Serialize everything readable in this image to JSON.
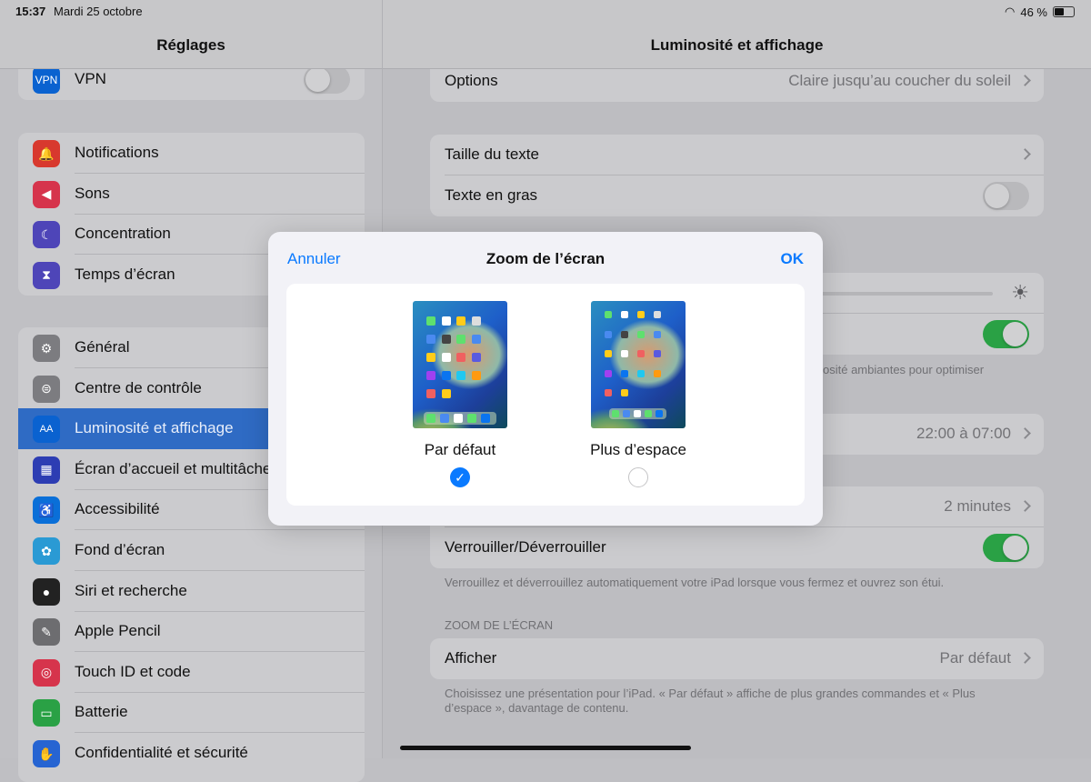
{
  "status": {
    "time": "15:37",
    "date": "Mardi 25 octobre",
    "battery": "46 %"
  },
  "sidebar": {
    "title": "Réglages",
    "vpn": {
      "label": "VPN",
      "icon": "VPN",
      "on": false
    },
    "group1": [
      {
        "label": "Notifications",
        "icon": "bell-icon",
        "color": "#d8392e"
      },
      {
        "label": "Sons",
        "icon": "speaker-icon",
        "color": "#d6344c"
      },
      {
        "label": "Concentration",
        "icon": "moon-icon",
        "color": "#4e45b8"
      },
      {
        "label": "Temps d’écran",
        "icon": "hourglass-icon",
        "color": "#4e45b8"
      }
    ],
    "group2": [
      {
        "label": "Général",
        "icon": "gear-icon",
        "color": "#7c7c80"
      },
      {
        "label": "Centre de contrôle",
        "icon": "switches-icon",
        "color": "#7c7c80"
      },
      {
        "label": "Luminosité et affichage",
        "icon": "AA",
        "color": "#0a62d0",
        "selected": true
      },
      {
        "label": "Écran d’accueil et multitâche",
        "icon": "grid-icon",
        "color": "#2d3db3"
      },
      {
        "label": "Accessibilité",
        "icon": "accessibility-icon",
        "color": "#0a6fd8"
      },
      {
        "label": "Fond d’écran",
        "icon": "flower-icon",
        "color": "#2a9ad4"
      },
      {
        "label": "Siri et recherche",
        "icon": "siri-icon",
        "color": "#222"
      },
      {
        "label": "Apple Pencil",
        "icon": "pencil-icon",
        "color": "#6d6d70"
      },
      {
        "label": "Touch ID et code",
        "icon": "fingerprint-icon",
        "color": "#d6344c"
      },
      {
        "label": "Batterie",
        "icon": "battery-icon",
        "color": "#2aa145"
      },
      {
        "label": "Confidentialité et sécurité",
        "icon": "hand-icon",
        "color": "#2664d2"
      }
    ]
  },
  "main": {
    "title": "Luminosité et affichage",
    "options": {
      "label": "Options",
      "value": "Claire jusqu’au coucher du soleil"
    },
    "text_size": "Taille du texte",
    "bold_text": "Texte en gras",
    "bold_on": false,
    "brightness": 0.12,
    "true_tone_on": true,
    "brightness_footer": "osité ambiantes pour optimiser",
    "night_shift_value": "22:00 à 07:00",
    "autolock_value": "2 minutes",
    "lock": {
      "label": "Verrouiller/Déverrouiller",
      "on": true,
      "footer": "Verrouillez et déverrouillez automatiquement votre iPad lorsque vous fermez et ouvrez son étui."
    },
    "zoom_section": "ZOOM DE L’ÉCRAN",
    "display": {
      "label": "Afficher",
      "value": "Par défaut",
      "footer1": "Choisissez une présentation pour l’iPad. « Par défaut » affiche de plus grandes commandes et « Plus",
      "footer2": "d’espace », davantage de contenu."
    }
  },
  "modal": {
    "cancel": "Annuler",
    "title": "Zoom de l’écran",
    "ok": "OK",
    "options": [
      {
        "label": "Par défaut",
        "selected": true
      },
      {
        "label": "Plus d’espace",
        "selected": false
      }
    ]
  },
  "colors": {
    "accent": "#0a7aff",
    "toggle_on": "#2aa145"
  }
}
